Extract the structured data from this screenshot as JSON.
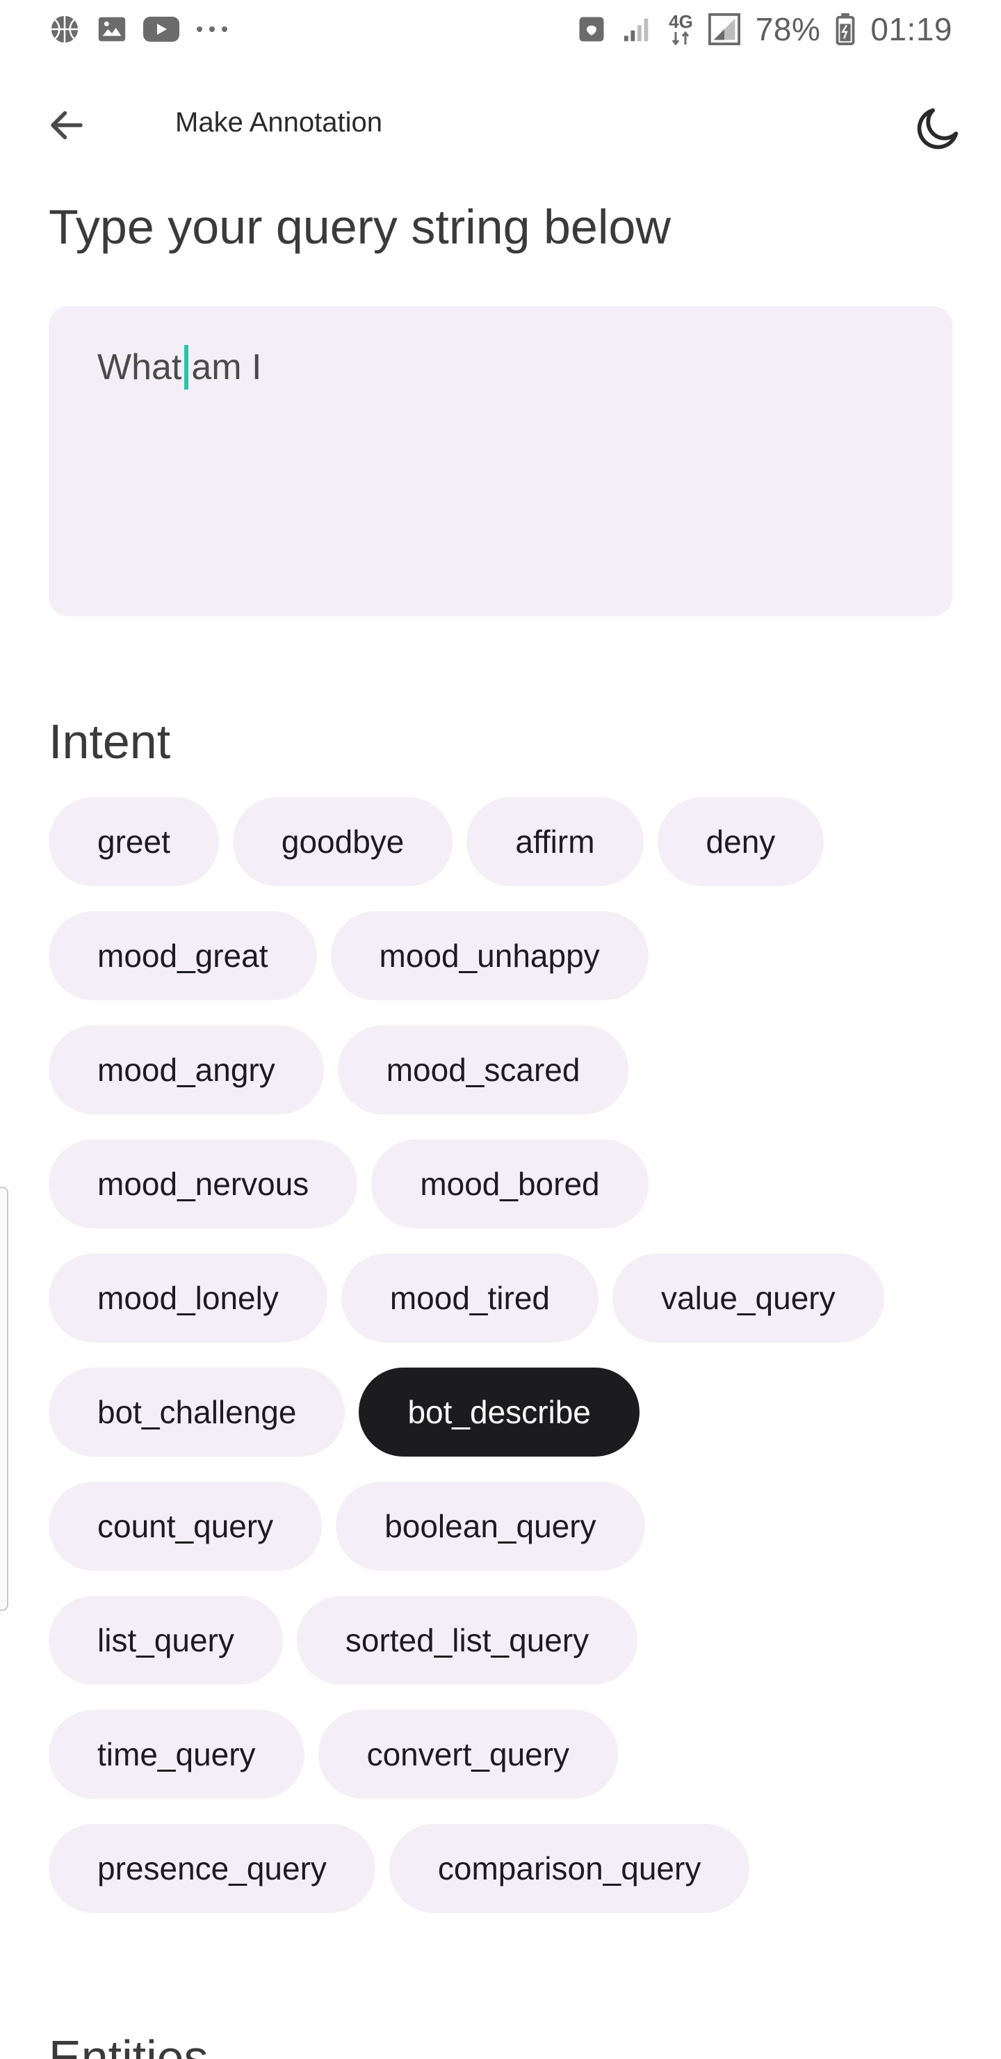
{
  "status_bar": {
    "battery": "78%",
    "time": "01:19",
    "network": "4G",
    "icons_left": [
      "basketball-icon",
      "image-icon",
      "youtube-icon",
      "more-dots-icon"
    ],
    "icons_right": [
      "nfc-icon",
      "signal-icon",
      "data-arrows-icon",
      "signal-icon-2",
      "battery-icon"
    ]
  },
  "app_bar": {
    "title": "Make Annotation",
    "back_icon": "arrow-back-icon",
    "theme_icon": "moon-icon"
  },
  "query": {
    "heading": "Type your query string below",
    "text_before_caret": "What",
    "text_after_caret": "am I"
  },
  "intent": {
    "heading": "Intent",
    "rows": [
      [
        "greet",
        "goodbye",
        "affirm",
        "deny"
      ],
      [
        "mood_great",
        "mood_unhappy"
      ],
      [
        "mood_angry",
        "mood_scared"
      ],
      [
        "mood_nervous",
        "mood_bored"
      ],
      [
        "mood_lonely",
        "mood_tired",
        "value_query"
      ],
      [
        "bot_challenge",
        "bot_describe"
      ],
      [
        "count_query",
        "boolean_query"
      ],
      [
        "list_query",
        "sorted_list_query"
      ],
      [
        "time_query",
        "convert_query"
      ],
      [
        "presence_query",
        "comparison_query"
      ]
    ],
    "selected": "bot_describe"
  },
  "entities": {
    "heading": "Entities"
  },
  "colors": {
    "chip_bg": "#f4eff6",
    "chip_selected_bg": "#1c1c1e",
    "caret": "#26c6b0"
  }
}
